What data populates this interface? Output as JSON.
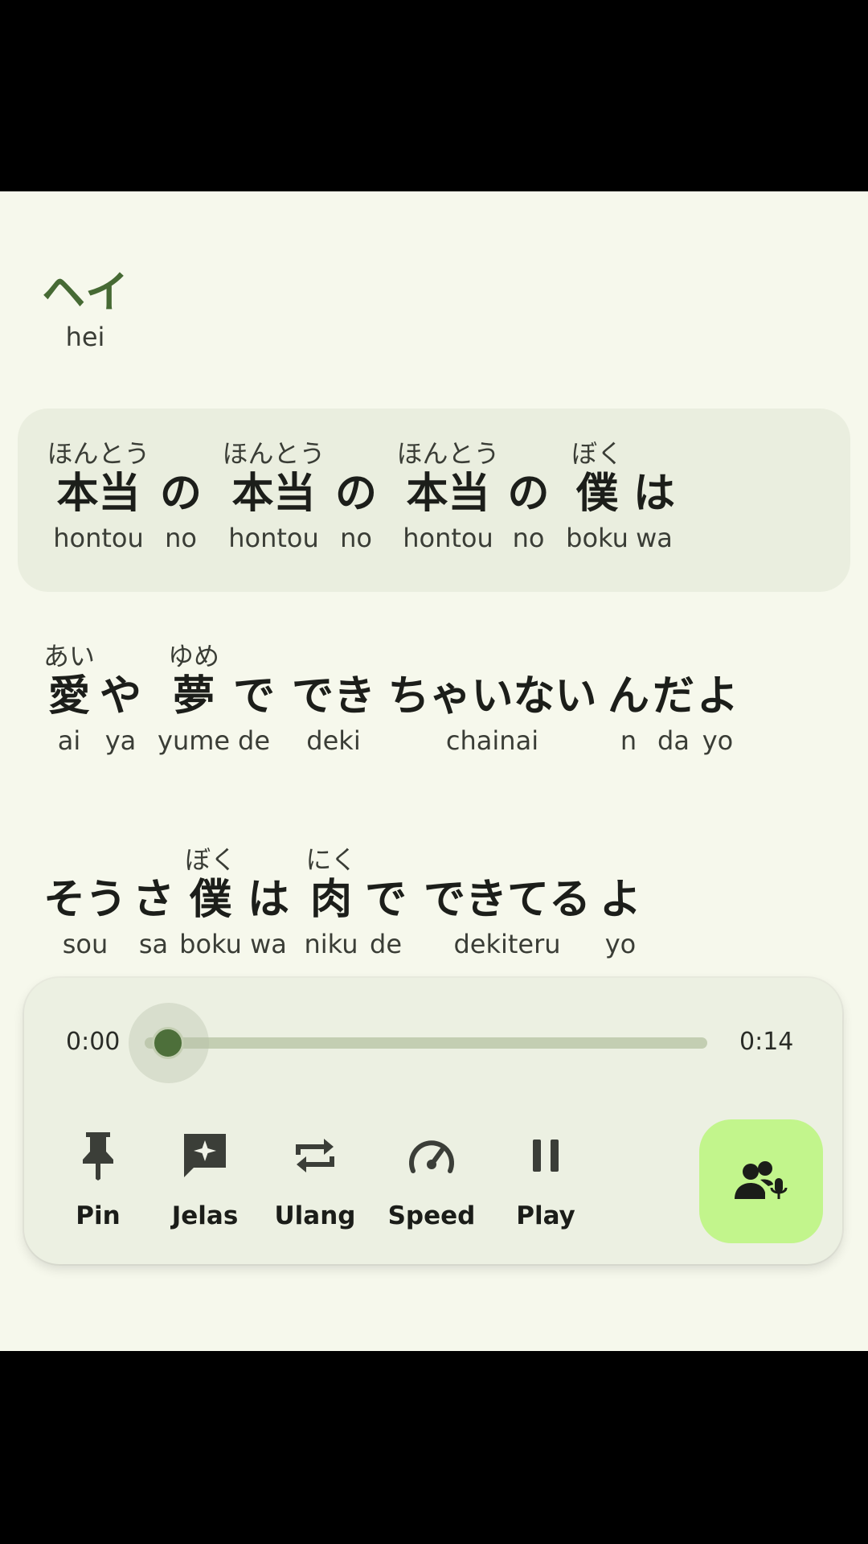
{
  "title_line": {
    "jp": "ヘイ",
    "romaji": "hei"
  },
  "lines": [
    [
      {
        "furi": "ほんとう",
        "jp": "本当",
        "romaji": "hontou"
      },
      {
        "furi": "",
        "jp": "の",
        "romaji": "no"
      },
      {
        "furi": "ほんとう",
        "jp": "本当",
        "romaji": "hontou"
      },
      {
        "furi": "",
        "jp": "の",
        "romaji": "no"
      },
      {
        "furi": "ほんとう",
        "jp": "本当",
        "romaji": "hontou"
      },
      {
        "furi": "",
        "jp": "の",
        "romaji": "no"
      },
      {
        "furi": "ぼく",
        "jp": "僕",
        "romaji": "boku"
      },
      {
        "furi": "",
        "jp": "は",
        "romaji": "wa"
      }
    ],
    [
      {
        "furi": "あい",
        "jp": "愛",
        "romaji": "ai"
      },
      {
        "furi": "",
        "jp": "や",
        "romaji": "ya"
      },
      {
        "furi": "ゆめ",
        "jp": "夢",
        "romaji": "yume"
      },
      {
        "furi": "",
        "jp": "で",
        "romaji": "de"
      },
      {
        "furi": "",
        "jp": "でき",
        "romaji": "deki"
      },
      {
        "furi": "",
        "jp": "ちゃいない",
        "romaji": "chainai"
      },
      {
        "furi": "",
        "jp": "ん",
        "romaji": "n"
      },
      {
        "furi": "",
        "jp": "だ",
        "romaji": "da"
      },
      {
        "furi": "",
        "jp": "よ",
        "romaji": "yo"
      }
    ],
    [
      {
        "furi": "",
        "jp": "そう",
        "romaji": "sou"
      },
      {
        "furi": "",
        "jp": "さ",
        "romaji": "sa"
      },
      {
        "furi": "ぼく",
        "jp": "僕",
        "romaji": "boku"
      },
      {
        "furi": "",
        "jp": "は",
        "romaji": "wa"
      },
      {
        "furi": "にく",
        "jp": "肉",
        "romaji": "niku"
      },
      {
        "furi": "",
        "jp": "で",
        "romaji": "de"
      },
      {
        "furi": "",
        "jp": "できてる",
        "romaji": "dekiteru"
      },
      {
        "furi": "",
        "jp": "よ",
        "romaji": "yo"
      }
    ]
  ],
  "active_line_index": 0,
  "player": {
    "current_time": "0:00",
    "total_time": "0:14",
    "progress_fraction": 0.0,
    "controls": [
      {
        "label": "Pin",
        "icon": "pin-icon"
      },
      {
        "label": "Jelas",
        "icon": "explain-sparkle-icon"
      },
      {
        "label": "Ulang",
        "icon": "repeat-icon"
      },
      {
        "label": "Speed",
        "icon": "speedometer-icon"
      },
      {
        "label": "Play",
        "icon": "pause-icon"
      }
    ],
    "fab_icon": "voice-group-icon"
  },
  "colors": {
    "background": "#f6f8ec",
    "accent": "#466a34",
    "fab": "#c2f58c",
    "track": "#c3ceb2"
  }
}
